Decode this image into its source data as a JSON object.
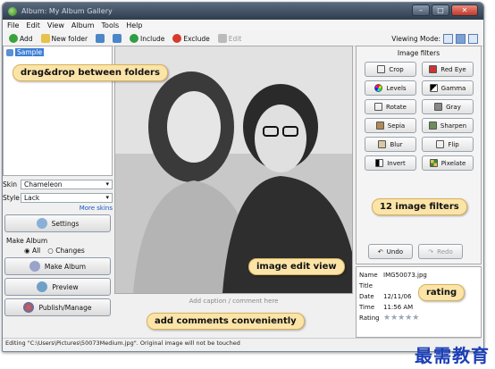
{
  "window": {
    "title": "Album: My Album Gallery"
  },
  "menu": [
    "File",
    "Edit",
    "View",
    "Album",
    "Tools",
    "Help"
  ],
  "toolbar": {
    "add": "Add",
    "new_folder": "New folder",
    "include": "Include",
    "exclude": "Exclude",
    "edit": "Edit",
    "viewing_mode": "Viewing Mode:"
  },
  "tree": {
    "root": "Sample"
  },
  "sidebar": {
    "skin_label": "Skin",
    "skin_value": "Chameleon",
    "style_label": "Style",
    "style_value": "Lack",
    "more_skins": "More skins",
    "settings": "Settings",
    "make_album_label": "Make Album",
    "all": "All",
    "changes": "Changes",
    "make_album_btn": "Make Album",
    "preview": "Preview",
    "publish": "Publish/Manage"
  },
  "filters": {
    "header": "Image filters",
    "items": [
      "Crop",
      "Red Eye",
      "Levels",
      "Gamma",
      "Rotate",
      "Gray",
      "Sepia",
      "Sharpen",
      "Blur",
      "Flip",
      "Invert",
      "Pixelate"
    ],
    "undo": "Undo",
    "redo": "Redo"
  },
  "info": {
    "name_k": "Name",
    "name_v": "IMG50073.jpg",
    "title_k": "Title",
    "date_k": "Date",
    "date_v": "12/11/06",
    "time_k": "Time",
    "time_v": "11:56 AM",
    "rating_k": "Rating",
    "rating_stars": "★★★★★"
  },
  "caption_placeholder": "Add caption / comment here",
  "status": "Editing \"C:\\Users\\Pictures\\50073Medium.jpg\". Original image will not be touched",
  "callouts": {
    "drag": "drag&drop between folders",
    "filters": "12 image filters",
    "edit": "image edit view",
    "rating": "rating",
    "comments": "add comments conveniently"
  },
  "watermark": "最需教育"
}
